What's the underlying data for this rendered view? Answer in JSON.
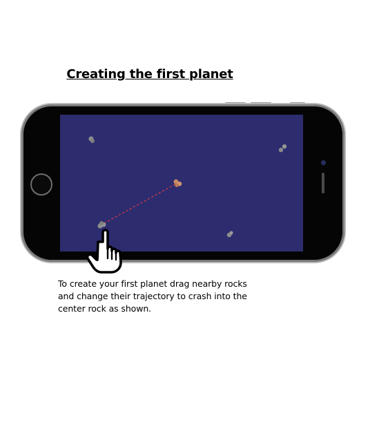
{
  "title": "Creating the first planet",
  "instructions": {
    "line1": "To create your first planet drag nearby rocks",
    "line2": "and change their trajectory to crash into the",
    "line3": "center rock as shown."
  },
  "colors": {
    "screen_background": "#2d2c6e",
    "rock": "#8c8c8c",
    "center_rock": "#c98a66",
    "trajectory": "#d23c4a"
  },
  "icons": {
    "hand": "pointing-hand-icon",
    "home": "home-button-icon"
  }
}
